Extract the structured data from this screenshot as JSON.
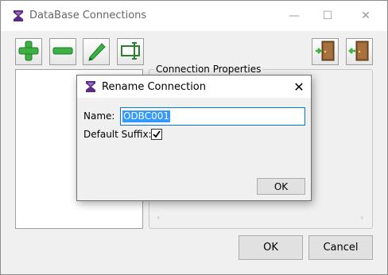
{
  "window": {
    "title": "DataBase Connections",
    "minimize_glyph": "—",
    "maximize_glyph": "☐",
    "close_glyph": "✕"
  },
  "toolbar": {
    "items": [
      {
        "name": "add-connection-button",
        "icon": "plus-icon",
        "color": "#3cb043"
      },
      {
        "name": "remove-connection-button",
        "icon": "minus-icon",
        "color": "#3cb043"
      },
      {
        "name": "edit-connection-button",
        "icon": "pencil-icon",
        "color": "#3cb043"
      },
      {
        "name": "rename-connection-button",
        "icon": "rename-field-icon",
        "color": "#2e7d32"
      },
      {
        "name": "import-button",
        "icon": "door-enter-icon",
        "color": "#8b5a2b"
      },
      {
        "name": "export-button",
        "icon": "door-exit-icon",
        "color": "#8b5a2b"
      }
    ]
  },
  "properties": {
    "legend": "Connection Properties",
    "scroll_left_glyph": "‹",
    "scroll_right_glyph": "›"
  },
  "footer": {
    "ok_label": "OK",
    "cancel_label": "Cancel"
  },
  "dialog": {
    "title": "Rename Connection",
    "close_glyph": "✕",
    "name_label": "Name:",
    "name_value": "ODBC001",
    "suffix_label": "Default Suffix:",
    "suffix_checked": true,
    "ok_label": "OK"
  },
  "colors": {
    "accent_green": "#3cb043",
    "selection_blue": "#3399ff",
    "focus_border": "#0078d7",
    "app_icon_purple": "#5b2c83"
  }
}
